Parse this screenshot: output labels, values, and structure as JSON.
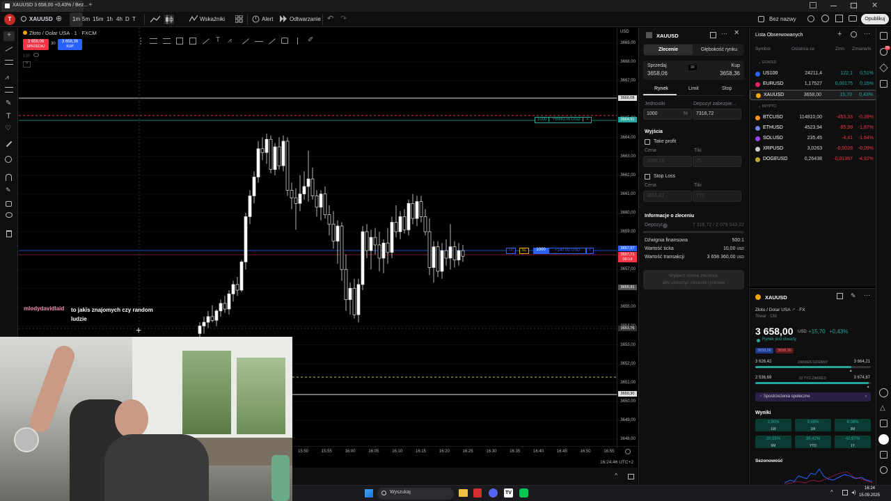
{
  "browser": {
    "tab_title": "XAUUSD  3 658,00 +0,43% / Bez...",
    "new_tab": "+"
  },
  "toolbar": {
    "symbol": "XAUUSD",
    "intervals": [
      "1m",
      "5m",
      "15m",
      "1h",
      "4h",
      "D",
      "T"
    ],
    "indicators": "Wskaźniki",
    "alert": "Alert",
    "replay": "Odtwarzanie",
    "layout_name": "Bez nazwy",
    "publish": "Opublikuj"
  },
  "chart": {
    "legend_title": "Złoto / Dolar USA · 1 · FXCM",
    "sell_price": "3 658,06",
    "sell_label": "SPRZEDAJ",
    "spread": "30",
    "buy_price": "3 658,36",
    "buy_label": "KUP",
    "volume_label": "100",
    "currency": "USD",
    "price_ticks": [
      "3669,00",
      "3668,00",
      "3667,00",
      "3666,00",
      "3665,00",
      "3664,00",
      "3663,00",
      "3662,00",
      "3661,00",
      "3660,00",
      "3659,00",
      "3658,00",
      "3657,00",
      "3656,00",
      "3655,00",
      "3654,00",
      "3653,00",
      "3652,00",
      "3651,00",
      "3650,00",
      "3649,00",
      "3648,00"
    ],
    "price_tags": {
      "top_line": "3666,08",
      "tp": "3664,91",
      "current_blue": "3657,97",
      "current_red": "3657,71",
      "countdown": "00:14",
      "gray1": "3655,91",
      "gray2": "3653,76",
      "bottom_line": "3650,30"
    },
    "time_ticks": [
      "15:50",
      "15:55",
      "16:00",
      "16:05",
      "16:10",
      "16:15",
      "16:20",
      "16:25",
      "16:30",
      "16:35",
      "16:40",
      "16:45",
      "16:50",
      "16:55"
    ],
    "clock": "16:24:46 UTC+2",
    "tp_order": {
      "qty": "1000",
      "pnl": "+6990,00 USD",
      "close": "×"
    },
    "position": {
      "tp": "TP",
      "sl": "SL",
      "qty": "1000",
      "pnl": "+140,00 USD",
      "close": "×"
    }
  },
  "stream_chat": {
    "user": "mlodydavidlaid",
    "message": "to jakis znajomych czy random ludzie"
  },
  "order_panel": {
    "symbol": "XAUUSD",
    "tabs": [
      "Zlecenie",
      "Głębokość rynku"
    ],
    "sell_label": "Sprzedaj",
    "sell_price": "3658,06",
    "spread": "30",
    "buy_label": "Kup",
    "buy_price": "3658,36",
    "order_types": [
      "Rynek",
      "Limit",
      "Stop"
    ],
    "units_label": "Jednostki",
    "margin_label": "Depozyt zabezpie...",
    "units_value": "1000",
    "units_suffix": "%",
    "margin_value": "7316,72",
    "exits_title": "Wyjścia",
    "take_profit": "Take profit",
    "price_label": "Cena",
    "ticks_label": "Tiki",
    "tp_price": "3660,19",
    "tp_ticks": "75",
    "stop_loss": "Stop Loss",
    "sl_price": "3651,41",
    "sl_ticks": "770",
    "info_title": "Informacje o zleceniu",
    "deposit_label": "Depozyt",
    "deposit_value": "7 316,72 / 2 079 043,22",
    "leverage_label": "Dźwignia finansowa",
    "leverage_value": "500:1",
    "tick_value_label": "Wartość ticka",
    "tick_value": "10,00",
    "tick_value_ccy": "USD",
    "tx_value_label": "Wartość transakcji",
    "tx_value": "3 658 360,00",
    "tx_value_ccy": "USD",
    "submit_line1": "Wybierz stronę zlecenia:",
    "submit_line2": "aby utworzyć zlecenie rynkowe"
  },
  "watchlist": {
    "title": "Lista Obserwowanych",
    "cols": [
      "Symbol",
      "Ostatnia ce",
      "Zmn",
      "Zmiana%"
    ],
    "section1": "GOATED",
    "section2": "KRYPTO",
    "rows1": [
      {
        "sym": "US100",
        "last": "24211,4",
        "chg": "122,1",
        "pct": "0,51%",
        "color": "#26a69a",
        "icon": "#2962ff"
      },
      {
        "sym": "EURUSD",
        "last": "1,17527",
        "chg": "0,00175",
        "pct": "0,15%",
        "color": "#26a69a",
        "icon": "#e91e63"
      },
      {
        "sym": "XAUUSD",
        "last": "3658,00",
        "chg": "15,70",
        "pct": "0,43%",
        "color": "#26a69a",
        "icon": "#f7a600"
      }
    ],
    "rows2": [
      {
        "sym": "BTCUSD",
        "last": "114810,00",
        "chg": "-453,33",
        "pct": "-0,39%",
        "color": "#f23645",
        "icon": "#f7931a"
      },
      {
        "sym": "ETHUSD",
        "last": "4523,94",
        "chg": "-85,99",
        "pct": "-1,87%",
        "color": "#f23645",
        "icon": "#7c7fe0"
      },
      {
        "sym": "SOLUSD",
        "last": "235,45",
        "chg": "-4,41",
        "pct": "-1,84%",
        "color": "#f23645",
        "icon": "#9945ff"
      },
      {
        "sym": "XRPUSD",
        "last": "3,0263",
        "chg": "-0,0028",
        "pct": "-0,09%",
        "color": "#f23645",
        "icon": "#cccccc"
      },
      {
        "sym": "DOGEUSD",
        "last": "0,26438",
        "chg": "-0,01367",
        "pct": "-4,92%",
        "color": "#f23645",
        "icon": "#c2a633"
      }
    ]
  },
  "details": {
    "symbol": "XAUUSD",
    "name": "Złoto / Dolar USA",
    "exchange": "FX",
    "type": "Towar · Cfd",
    "price": "3 658,00",
    "currency": "USD",
    "change": "+15,70",
    "change_pct": "+0,43%",
    "market_status": "Rynek jest otwarty",
    "bid_tag": "3658,06",
    "ask_tag": "3658,36",
    "day_low": "3 626,42",
    "day_range_label": "ZAKRES DZIENNY",
    "day_high": "3 664,21",
    "w52_low": "2 536,69",
    "w52_label": "52 TYG ZAKRES",
    "w52_high": "3 674,87",
    "day_pos": 0.83,
    "w52_pos": 0.98,
    "insights": "Spostrzeżenia społeczne",
    "results_title": "Wyniki",
    "perf": [
      {
        "v": "1,90%",
        "p": "1W"
      },
      {
        "v": "9,68%",
        "p": "1M"
      },
      {
        "v": "8,08%",
        "p": "3M"
      },
      {
        "v": "20,55%",
        "p": "6M"
      },
      {
        "v": "39,42%",
        "p": "YTD"
      },
      {
        "v": "42,97%",
        "p": "1Y"
      }
    ],
    "seasonality": "Sezonowość"
  },
  "taskbar": {
    "search": "Wyszukaj",
    "time": "16:24",
    "date": "15.09.2025"
  }
}
